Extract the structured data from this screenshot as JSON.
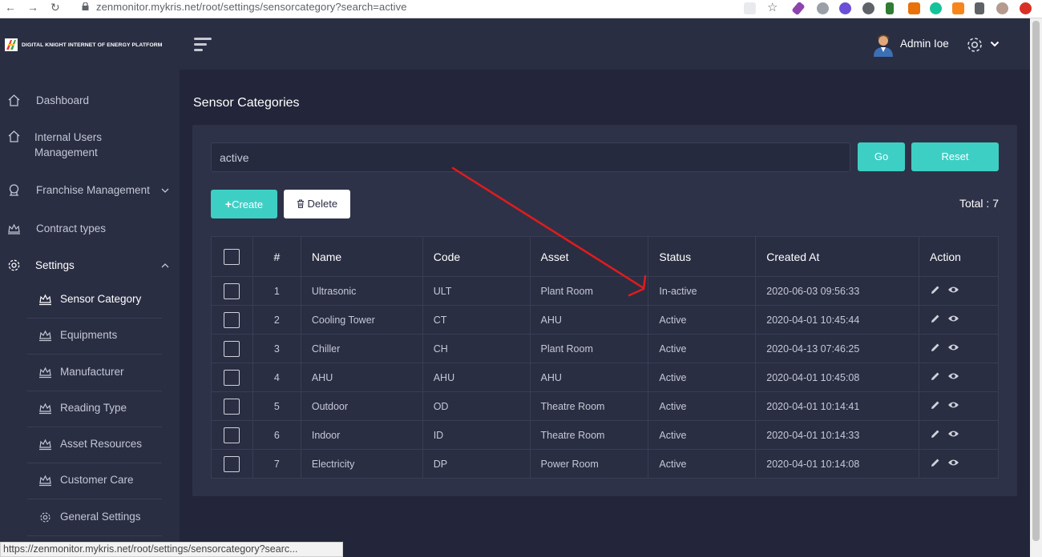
{
  "browser": {
    "url": "zenmonitor.mykris.net/root/settings/sensorcategory?search=active",
    "status_url": "https://zenmonitor.mykris.net/root/settings/sensorcategory?searc..."
  },
  "brand": {
    "name": "DIGITAL KNIGHT INTERNET OF ENERGY PLATFORM"
  },
  "header": {
    "user_name": "Admin Ioe"
  },
  "sidebar": {
    "items": [
      {
        "label": "Dashboard",
        "icon": "home-icon"
      },
      {
        "label": "Internal Users",
        "label2": "Management",
        "icon": "home-icon"
      },
      {
        "label": "Franchise Management",
        "icon": "franchise-icon"
      },
      {
        "label": "Contract types",
        "icon": "crown-icon"
      },
      {
        "label": "Settings",
        "icon": "gear-icon"
      }
    ],
    "sub_items": [
      {
        "label": "Sensor Category"
      },
      {
        "label": "Equipments"
      },
      {
        "label": "Manufacturer"
      },
      {
        "label": "Reading Type"
      },
      {
        "label": "Asset Resources"
      },
      {
        "label": "Customer Care"
      },
      {
        "label": "General Settings"
      }
    ]
  },
  "main": {
    "title": "Sensor Categories",
    "search_value": "active",
    "go_label": "Go",
    "reset_label": "Reset",
    "create_label": "Create",
    "delete_label": "Delete",
    "total_label": "Total : 7"
  },
  "table": {
    "headers": [
      "#",
      "Name",
      "Code",
      "Asset",
      "Status",
      "Created At",
      "Action"
    ],
    "rows": [
      [
        "1",
        "Ultrasonic",
        "ULT",
        "Plant Room",
        "In-active",
        "2020-06-03 09:56:33"
      ],
      [
        "2",
        "Cooling Tower",
        "CT",
        "AHU",
        "Active",
        "2020-04-01 10:45:44"
      ],
      [
        "3",
        "Chiller",
        "CH",
        "Plant Room",
        "Active",
        "2020-04-13 07:46:25"
      ],
      [
        "4",
        "AHU",
        "AHU",
        "AHU",
        "Active",
        "2020-04-01 10:45:08"
      ],
      [
        "5",
        "Outdoor",
        "OD",
        "Theatre Room",
        "Active",
        "2020-04-01 10:14:41"
      ],
      [
        "6",
        "Indoor",
        "ID",
        "Theatre Room",
        "Active",
        "2020-04-01 10:14:33"
      ],
      [
        "7",
        "Electricity",
        "DP",
        "Power Room",
        "Active",
        "2020-04-01 10:14:08"
      ]
    ]
  },
  "colors": {
    "accent": "#3ecfc4",
    "sidebar": "#2a2e43",
    "background": "#23263a",
    "annotation": "#e21b1b"
  }
}
